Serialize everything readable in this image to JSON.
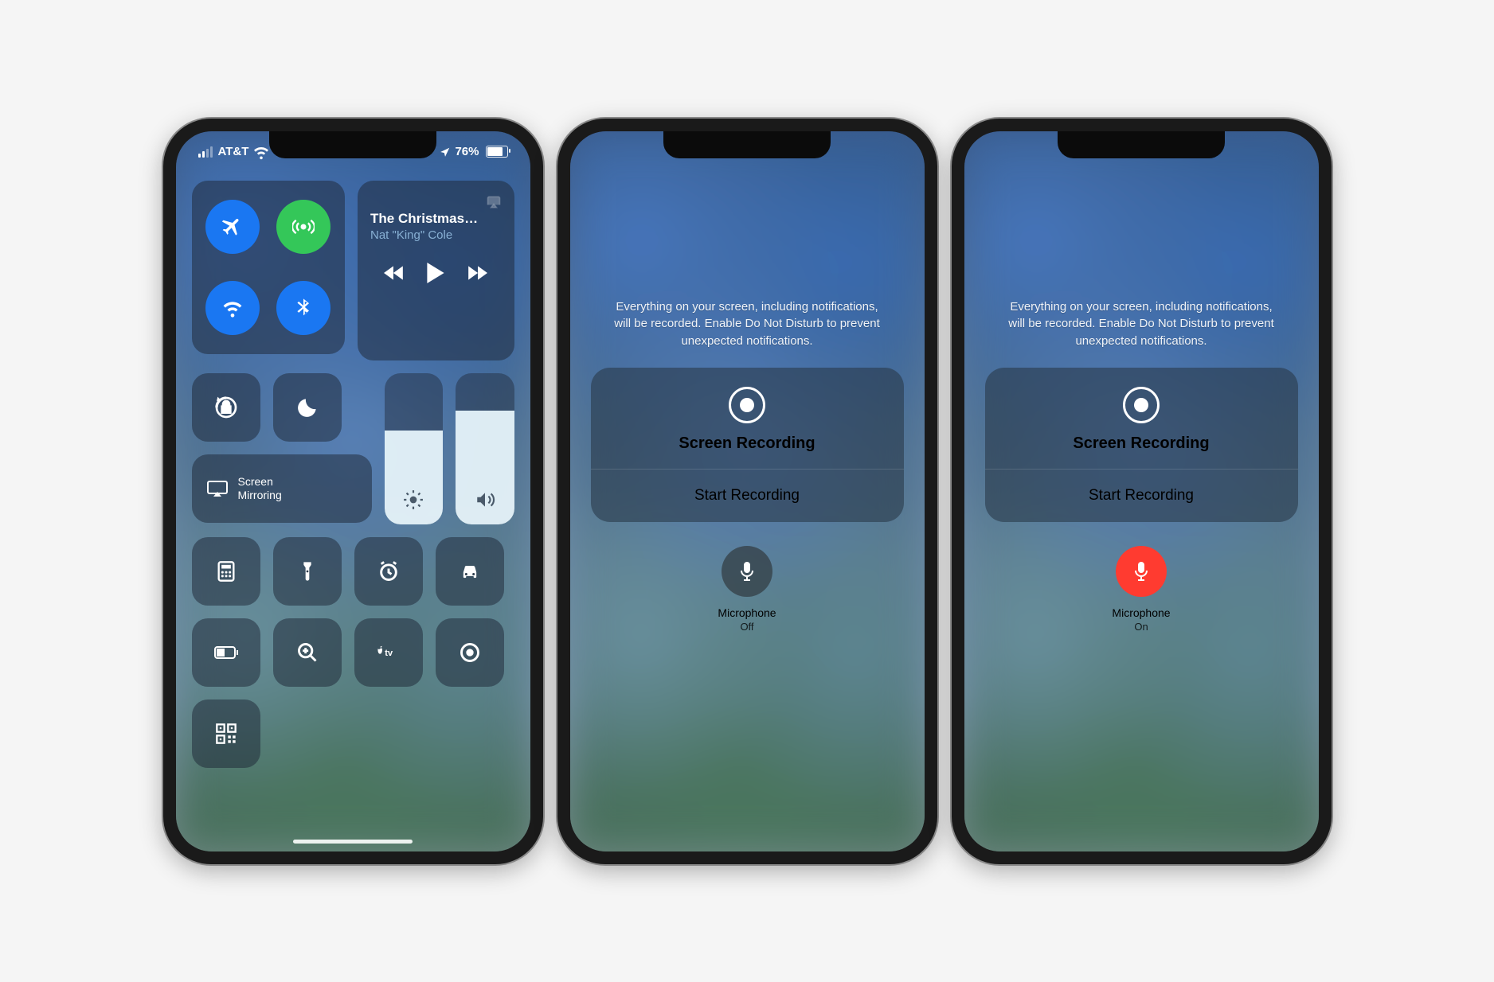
{
  "status": {
    "carrier": "AT&T",
    "battery": "76%"
  },
  "media": {
    "title": "The Christmas…",
    "subtitle": "Nat \"King\" Cole"
  },
  "screen_mirroring": {
    "label": "Screen Mirroring"
  },
  "recording": {
    "disclaimer": "Everything on your screen, including notifications, will be recorded. Enable Do Not Disturb to prevent unexpected notifications.",
    "title": "Screen Recording",
    "start": "Start Recording",
    "mic_label": "Microphone",
    "mic_off": "Off",
    "mic_on": "On"
  }
}
